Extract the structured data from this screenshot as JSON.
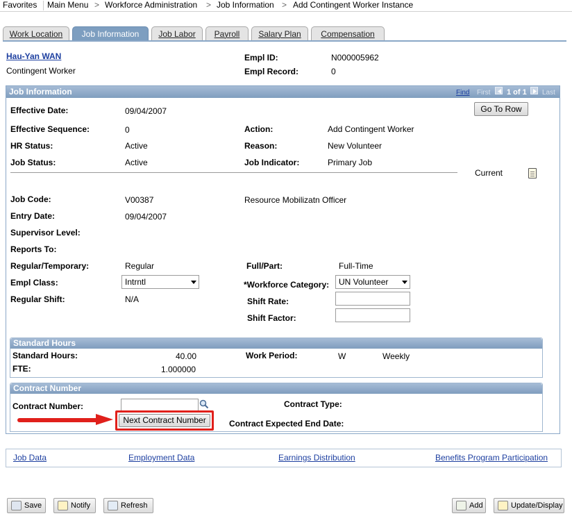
{
  "breadcrumb": {
    "items": [
      "Favorites",
      "Main Menu",
      "Workforce Administration",
      "Job Information",
      "Add Contingent Worker Instance"
    ],
    "separator": ">"
  },
  "tabs": [
    {
      "label": "Work Location",
      "active": false
    },
    {
      "label": "Job Information",
      "active": true
    },
    {
      "label": "Job Labor",
      "active": false
    },
    {
      "label": "Payroll",
      "active": false
    },
    {
      "label": "Salary Plan",
      "active": false
    },
    {
      "label": "Compensation",
      "active": false
    }
  ],
  "header": {
    "name": "Hau-Yan WAN",
    "type": "Contingent Worker",
    "empl_id_label": "Empl ID:",
    "empl_id": "N000005962",
    "empl_record_label": "Empl Record:",
    "empl_record": "0"
  },
  "job_info": {
    "title": "Job Information",
    "nav": {
      "find": "Find",
      "first": "First",
      "count": "1 of 1",
      "last": "Last"
    },
    "go_to_row": "Go To Row",
    "effective_date_label": "Effective Date:",
    "effective_date": "09/04/2007",
    "effective_sequence_label": "Effective Sequence:",
    "effective_sequence": "0",
    "action_label": "Action:",
    "action": "Add Contingent Worker",
    "hr_status_label": "HR Status:",
    "hr_status": "Active",
    "reason_label": "Reason:",
    "reason": "New Volunteer",
    "job_status_label": "Job Status:",
    "job_status": "Active",
    "job_indicator_label": "Job Indicator:",
    "job_indicator": "Primary Job",
    "current": "Current",
    "job_code_label": "Job Code:",
    "job_code": "V00387",
    "job_code_desc": "Resource Mobilizatn Officer",
    "entry_date_label": "Entry Date:",
    "entry_date": "09/04/2007",
    "supervisor_level_label": "Supervisor Level:",
    "reports_to_label": "Reports To:",
    "regular_temporary_label": "Regular/Temporary:",
    "regular_temporary": "Regular",
    "full_part_label": "Full/Part:",
    "full_part": "Full-Time",
    "empl_class_label": "Empl Class:",
    "empl_class": "Intrntl",
    "workforce_category_label": "*Workforce Category:",
    "workforce_category": "UN Volunteer",
    "regular_shift_label": "Regular Shift:",
    "regular_shift": "N/A",
    "shift_rate_label": "Shift Rate:",
    "shift_factor_label": "Shift Factor:"
  },
  "standard_hours": {
    "title": "Standard Hours",
    "standard_hours_label": "Standard Hours:",
    "standard_hours": "40.00",
    "work_period_label": "Work Period:",
    "work_period_code": "W",
    "work_period_desc": "Weekly",
    "fte_label": "FTE:",
    "fte": "1.000000"
  },
  "contract": {
    "title": "Contract Number",
    "contract_number_label": "Contract Number:",
    "contract_type_label": "Contract Type:",
    "next_button": "Next Contract Number",
    "end_date_label": "Contract Expected End Date:"
  },
  "links": [
    "Job Data",
    "Employment Data",
    "Earnings Distribution",
    "Benefits Program Participation"
  ],
  "toolbar": {
    "save": "Save",
    "notify": "Notify",
    "refresh": "Refresh",
    "add": "Add",
    "update_display": "Update/Display"
  },
  "colors": {
    "section_header": "#7f9dbe",
    "link": "#1d3fa0",
    "highlight_arrow": "#e0201b"
  }
}
